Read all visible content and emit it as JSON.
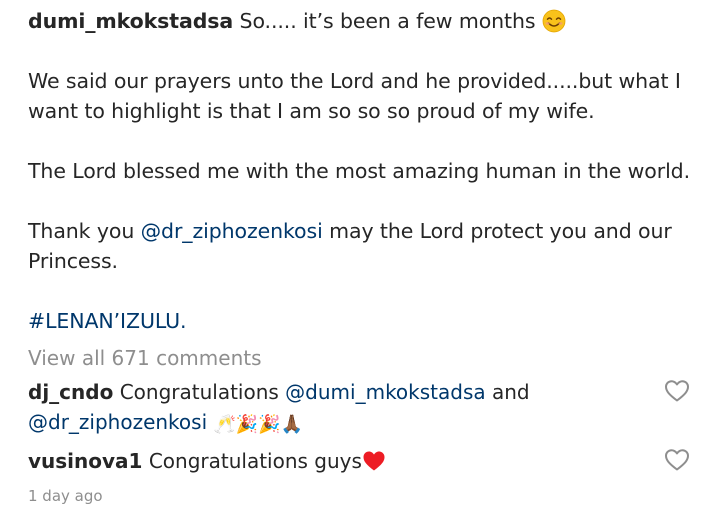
{
  "post": {
    "author": "dumi_mkokstadsa",
    "line1_text": "So..... it’s been a few months",
    "paragraph2": "We said our prayers unto the Lord and he provided.....but what I want to highlight is that I am so so so proud of my wife.",
    "paragraph3": "The Lord blessed me with the most amazing human in the world.",
    "paragraph4_prefix": "Thank you",
    "paragraph4_mention": "@dr_ziphozenkosi",
    "paragraph4_suffix": "may the Lord protect you and our Princess.",
    "hashtag": "#LENAN’IZULU."
  },
  "view_all_comments": "View all 671 comments",
  "comments": [
    {
      "user": "dj_cndo",
      "text_prefix": "Congratulations",
      "mention1": "@dumi_mkokstadsa",
      "text_middle": "and",
      "mention2": "@dr_ziphozenkosi",
      "emojis": "🥂🎉🎉🙏🏾"
    },
    {
      "user": "vusinova1",
      "text": "Congratulations guys"
    }
  ],
  "timestamp": "1 day ago",
  "colors": {
    "text": "#262626",
    "link": "#00376b",
    "muted": "#8e8e8e",
    "heart_red": "#ed1c24"
  },
  "icons": {
    "smile_emoji": "smiling-face-emoji",
    "red_heart": "red-heart-emoji",
    "like": "heart-outline-icon"
  }
}
